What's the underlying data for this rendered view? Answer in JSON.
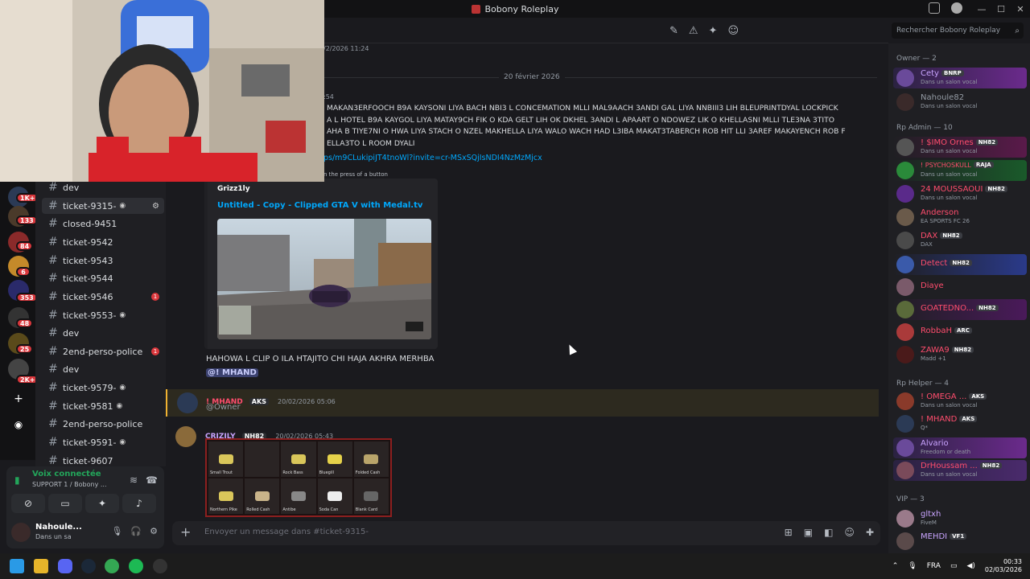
{
  "window": {
    "title": "Bobony Roleplay"
  },
  "search": {
    "placeholder": "Rechercher Bobony Roleplay"
  },
  "server_badges": [
    "1K+",
    "133",
    "84",
    "6",
    "353",
    "48",
    "25",
    "2K+"
  ],
  "channels": [
    {
      "name": "dev"
    },
    {
      "name": "ticket-9315-",
      "active": true
    },
    {
      "name": "closed-9451"
    },
    {
      "name": "ticket-9542"
    },
    {
      "name": "ticket-9543"
    },
    {
      "name": "ticket-9544"
    },
    {
      "name": "ticket-9546",
      "ping": "1"
    },
    {
      "name": "ticket-9553-"
    },
    {
      "name": "dev"
    },
    {
      "name": "2end-perso-police",
      "ping": "1"
    },
    {
      "name": "dev"
    },
    {
      "name": "ticket-9579-"
    },
    {
      "name": "ticket-9581"
    },
    {
      "name": "2end-perso-police"
    },
    {
      "name": "ticket-9591-"
    },
    {
      "name": "ticket-9607"
    }
  ],
  "voice_panel": {
    "status": "Voix connectée",
    "channel": "SUPPORT 1 / Bobony ...",
    "user": {
      "name": "Nahoule...",
      "status": "Dans un sa"
    }
  },
  "chat": {
    "top_timestamp": "/2/2026 11:24",
    "date_divider": "20 février 2026",
    "partial_time": ":54",
    "long_message": "MAKAN3ERFOOCH B9A KAYSONI LIYA BACH NBI3 L CONCEMATION MLLI MAL9AACH 3ANDI GAL LIYA NNBIII3 LIH BLEUPRINTDYAL LOCKPICK\nA L HOTEL B9A KAYGOL LIYA MATAY9CH FIK O KDA GELT LIH OK DKHEL 3ANDI L APAART O NDOWEZ LIK O KHELLASNI MLLI TLE3NA 3TITO\nAHA B TIYE7NI O HWA LIYA STACH O NZEL MAKHELLA LIYA WALO WACH HAD L3IBA MAKAT3TABERCH ROB HIT LLI 3AREF MAKAYENCH ROB F\nELLA3TO L ROOM DYALI",
    "link": "ps/m9CLukipiJT4tnoWl?invite=cr-MSxSQjIsNDI4NzMzMjcx",
    "embed_provider": "n the press of a button",
    "embed_author": "Grizz1ly",
    "embed_title": "Untitled - Copy - Clipped GTA V with Medal.tv",
    "followup_text": "HAHOWA L CLIP O ILA HTAJITO CHI HAJA AKHRA MERHBA",
    "followup_mention": "@! MHAND",
    "msg2": {
      "author": "! MHAND",
      "tag": "AKS",
      "timestamp": "20/02/2026 05:06",
      "text": "@Owner"
    },
    "msg3": {
      "author": "CRIZILY",
      "tag": "NH82",
      "timestamp": "20/02/2026 05:43"
    },
    "inventory": [
      "Small Trout",
      "",
      "Rock Bass",
      "Bluegill",
      "Folded Cash",
      "Northern Pike",
      "Rolled Cash",
      "Antibe",
      "Soda Can",
      "Blank Card"
    ],
    "composer_placeholder": "Envoyer un message dans #ticket-9315-"
  },
  "members": {
    "groups": [
      {
        "title": "Owner — 2",
        "items": [
          {
            "name": "Cety",
            "tag": "BNRP",
            "status": "Dans un salon vocal",
            "color": "#c9a4ff"
          },
          {
            "name": "Nahoule82",
            "status": "Dans un salon vocal",
            "color": "#949ba4"
          }
        ]
      },
      {
        "title": "Rp Admin — 10",
        "items": [
          {
            "name": "! $IMO Ornes",
            "tag": "NH82",
            "status": "Dans un salon vocal",
            "color": "#ff4d6d"
          },
          {
            "name": "! PSYCHOSKULL",
            "tag": "RAJA",
            "status": "Dans un salon vocal",
            "color": "#ff4d6d"
          },
          {
            "name": "24 MOUSSAOUI",
            "tag": "NH82",
            "status": "Dans un salon vocal",
            "color": "#ff4d6d"
          },
          {
            "name": "Anderson",
            "status": "EA SPORTS FC 26",
            "color": "#ff4d6d"
          },
          {
            "name": "DAX",
            "tag": "NH82",
            "status": "DAX",
            "color": "#ff4d6d"
          },
          {
            "name": "Detect",
            "tag": "NH82",
            "status": "",
            "color": "#ff4d6d"
          },
          {
            "name": "Diaye",
            "status": "",
            "color": "#ff4d6d"
          },
          {
            "name": "GOATEDNO...",
            "tag": "NH82",
            "status": "",
            "color": "#ff4d6d"
          },
          {
            "name": "RobbaH",
            "tag": "ARC",
            "status": "",
            "color": "#ff4d6d"
          },
          {
            "name": "ZAWA9",
            "tag": "NH82",
            "status": "Madd +1",
            "color": "#ff4d6d"
          }
        ]
      },
      {
        "title": "Rp Helper — 4",
        "items": [
          {
            "name": "! OMEGA ...",
            "tag": "AKS",
            "status": "Dans un salon vocal",
            "color": "#ff4d6d"
          },
          {
            "name": "! MHAND",
            "tag": "AKS",
            "status": "Q* ",
            "color": "#ff4d6d"
          },
          {
            "name": "Alvario",
            "status": "Freedom or death",
            "color": "#c9a4ff"
          },
          {
            "name": "DrHoussam ...",
            "tag": "NH82",
            "status": "Dans un salon vocal",
            "color": "#ff4d6d"
          }
        ]
      },
      {
        "title": "VIP — 3",
        "items": [
          {
            "name": "gltxh",
            "status": "FiveM",
            "color": "#c9a4ff"
          },
          {
            "name": "MEHDI",
            "tag": "VF1",
            "status": "",
            "color": "#c9a4ff"
          }
        ]
      }
    ]
  },
  "taskbar": {
    "lang": "FRA",
    "time": "00:33",
    "date": "02/03/2026"
  },
  "colors": {
    "accent": "#5865f2",
    "mention_bg": "#3c4270",
    "danger": "#da373c",
    "online": "#23a55a"
  }
}
